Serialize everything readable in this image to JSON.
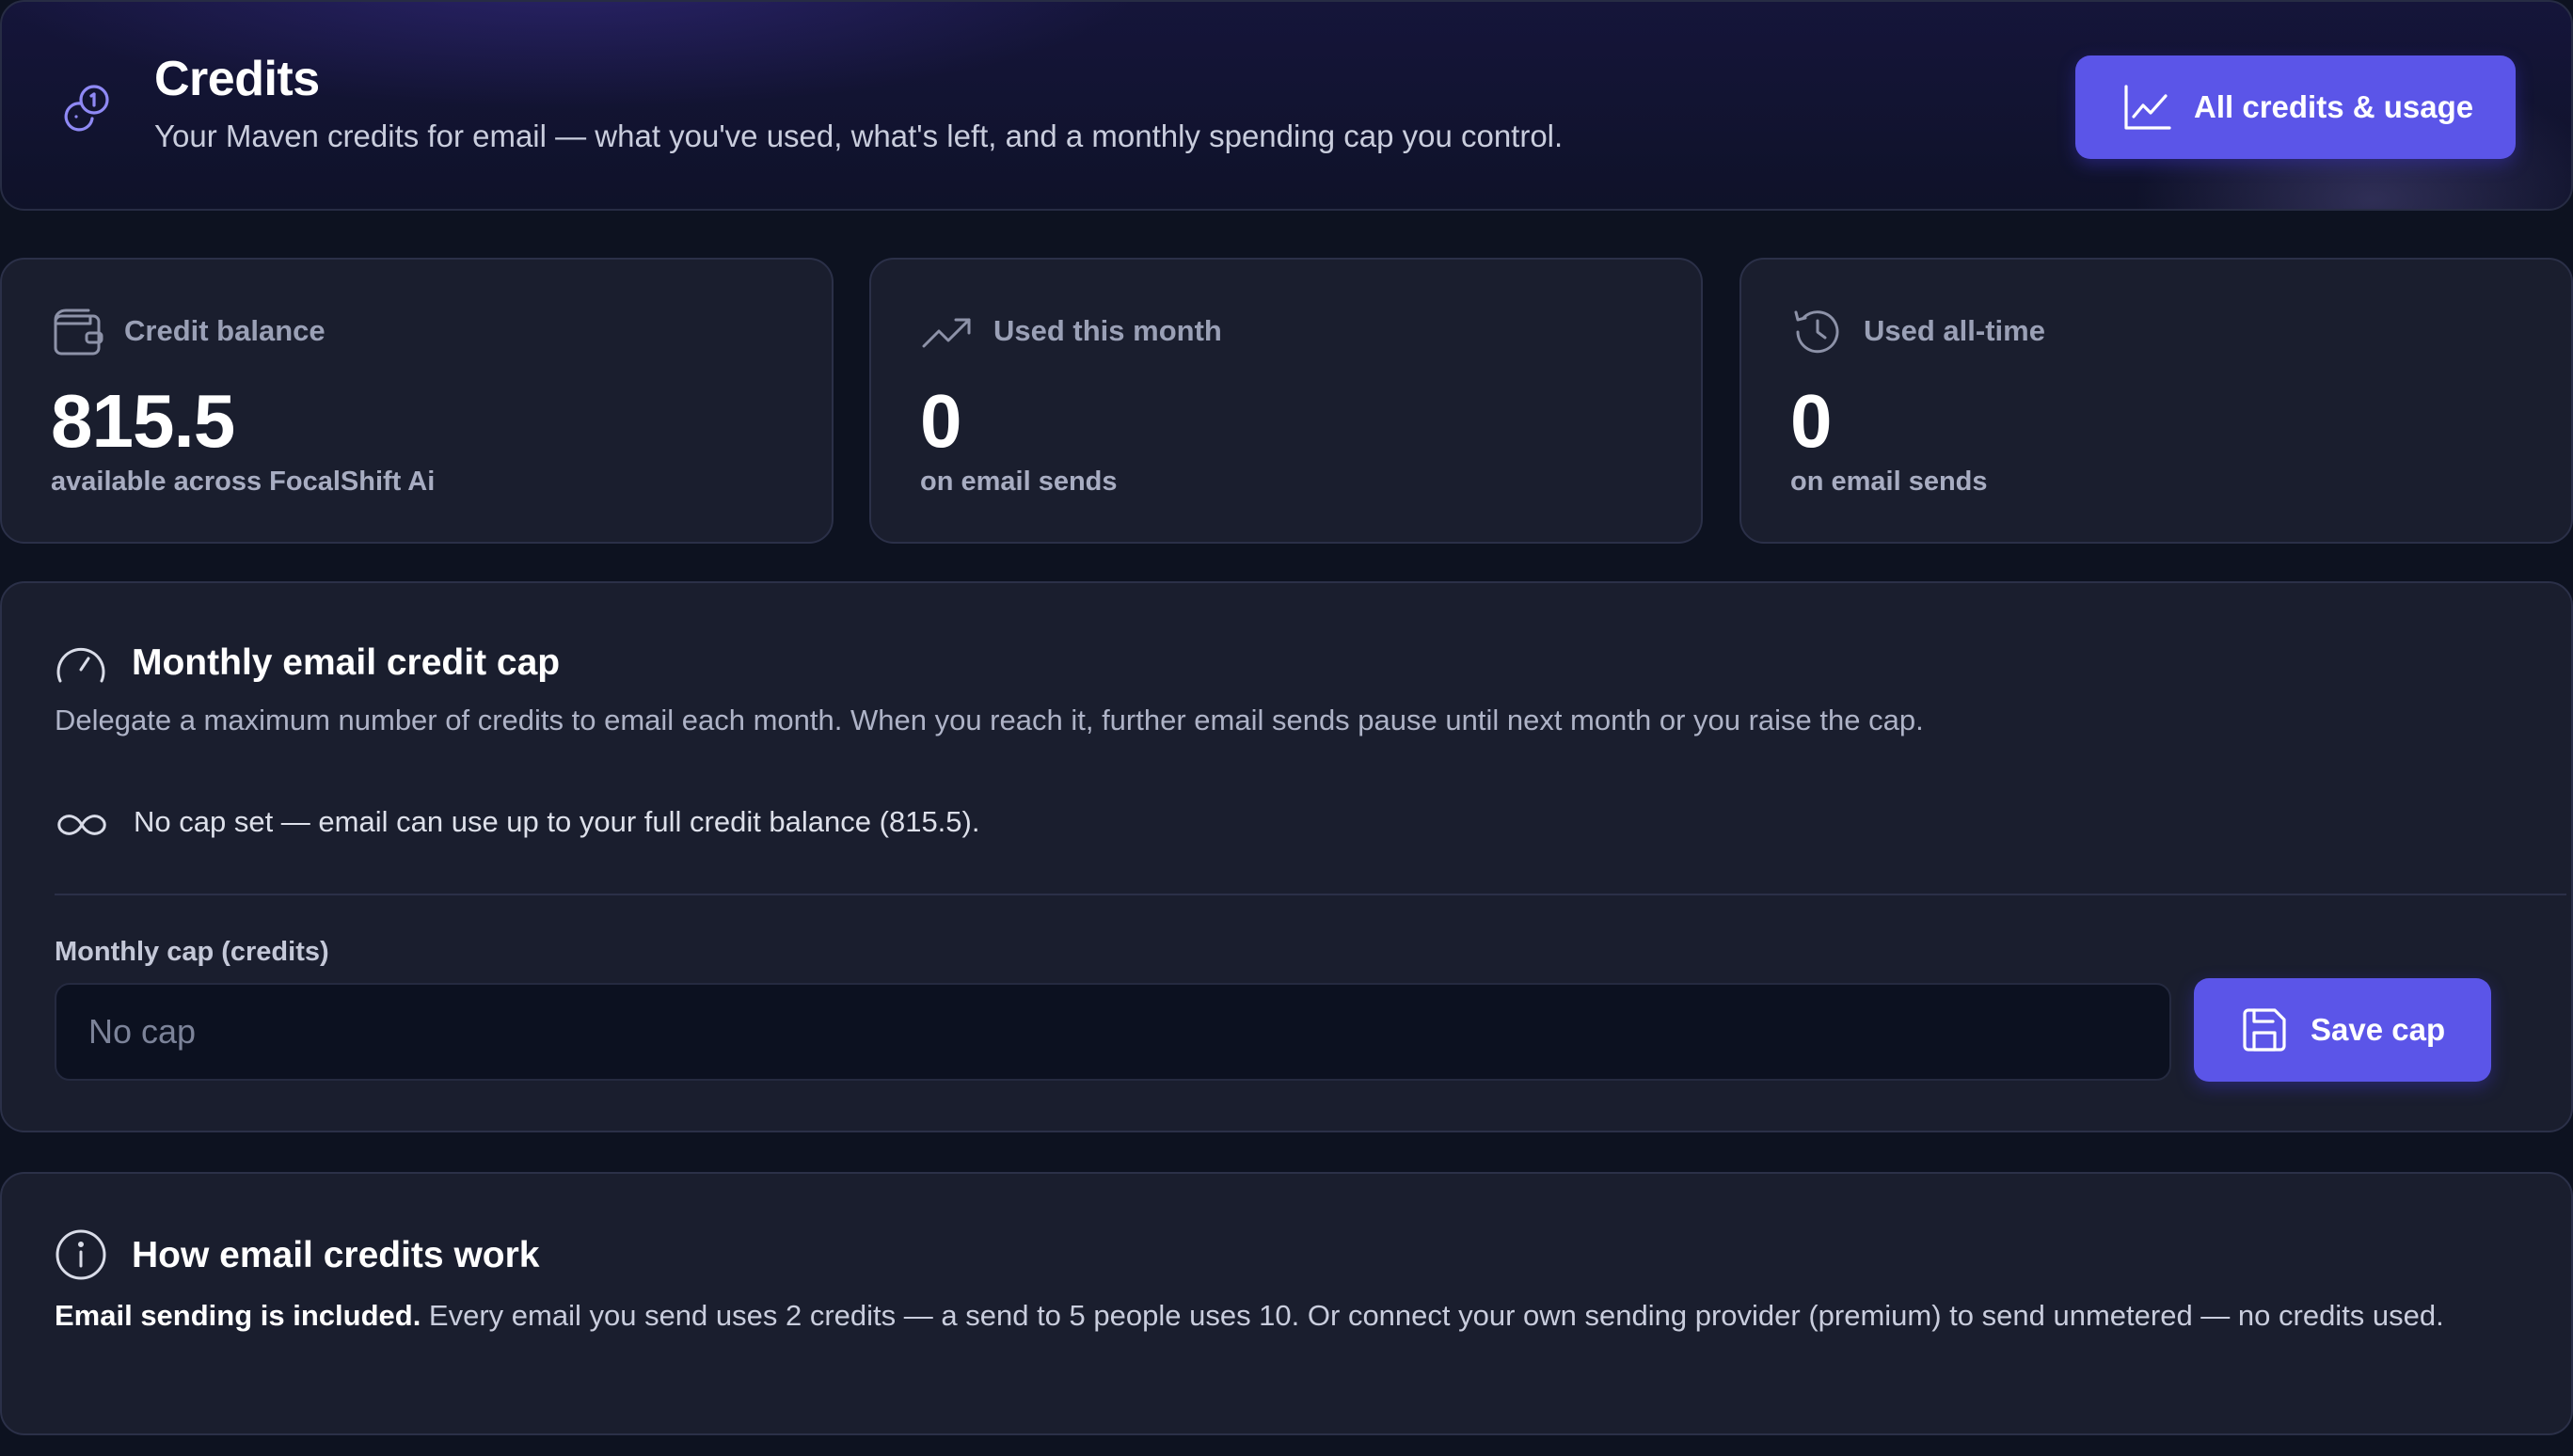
{
  "header": {
    "title": "Credits",
    "subtitle": "Your Maven credits for email — what you've used, what's left, and a monthly spending cap you control.",
    "usage_button_label": "All credits & usage"
  },
  "stats": [
    {
      "label": "Credit balance",
      "value": "815.5",
      "caption": "available across FocalShift Ai",
      "icon": "wallet-icon"
    },
    {
      "label": "Used this month",
      "value": "0",
      "caption": "on email sends",
      "icon": "trending-up-icon"
    },
    {
      "label": "Used all-time",
      "value": "0",
      "caption": "on email sends",
      "icon": "history-icon"
    }
  ],
  "cap": {
    "title": "Monthly email credit cap",
    "description": "Delegate a maximum number of credits to email each month. When you reach it, further email sends pause until next month or you raise the cap.",
    "status": "No cap set — email can use up to your full credit balance (815.5).",
    "field_label": "Monthly cap (credits)",
    "input_value": "",
    "input_placeholder": "No cap",
    "save_label": "Save cap"
  },
  "info": {
    "title": "How email credits work",
    "lead": "Email sending is included.",
    "body": " Every email you send uses 2 credits — a send to 5 people uses 10. Or connect your own sending provider (premium) to send unmetered — no credits used."
  },
  "colors": {
    "accent": "#5b55e8",
    "background": "#0d1220",
    "card": "#1a1e2e"
  }
}
